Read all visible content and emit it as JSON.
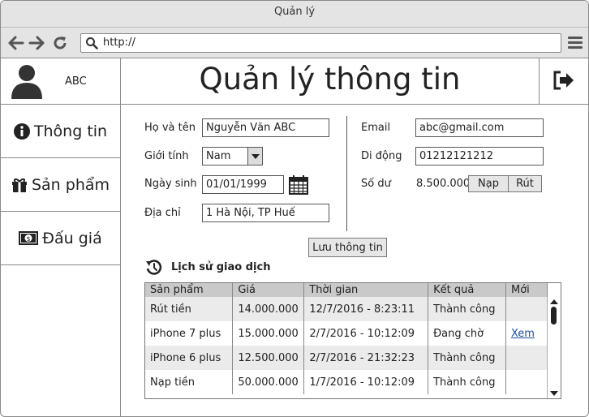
{
  "window": {
    "title": "Quản lý"
  },
  "browser": {
    "url": "http://"
  },
  "user": {
    "name": "ABC"
  },
  "sidebar": {
    "items": [
      {
        "label": "Thông tin",
        "icon": "info-icon"
      },
      {
        "label": "Sản phẩm",
        "icon": "gift-icon"
      },
      {
        "label": "Đấu giá",
        "icon": "money-icon"
      }
    ]
  },
  "header": {
    "title": "Quản lý thông tin"
  },
  "form": {
    "fullname_label": "Họ và tên",
    "fullname_value": "Nguyễn Văn ABC",
    "gender_label": "Giới tính",
    "gender_value": "Nam",
    "dob_label": "Ngày sinh",
    "dob_value": "01/01/1999",
    "address_label": "Địa chỉ",
    "address_value": "1 Hà Nội, TP Huế",
    "email_label": "Email",
    "email_value": "abc@gmail.com",
    "phone_label": "Di động",
    "phone_value": "01212121212",
    "balance_label": "Số dư",
    "balance_value": "8.500.000",
    "deposit_label": "Nạp",
    "withdraw_label": "Rút",
    "save_label": "Lưu thông tin"
  },
  "history": {
    "title": "Lịch sử giao dịch",
    "columns": [
      "Sản phẩm",
      "Giá",
      "Thời gian",
      "Kết quả",
      "Mới"
    ],
    "rows": [
      [
        "Rút tiền",
        "14.000.000",
        "12/7/2016 - 8:23:11",
        "Thành công",
        ""
      ],
      [
        "iPhone 7 plus",
        "15.000.000",
        "2/7/2016 - 10:12:09",
        "Đang chờ",
        "Xem"
      ],
      [
        "iPhone 6 plus",
        "12.500.000",
        "2/7/2016 - 21:32:23",
        "Thành công",
        ""
      ],
      [
        "Nạp tiền",
        "50.000.000",
        "1/7/2016 - 10:12:09",
        "Thành công",
        ""
      ]
    ]
  }
}
